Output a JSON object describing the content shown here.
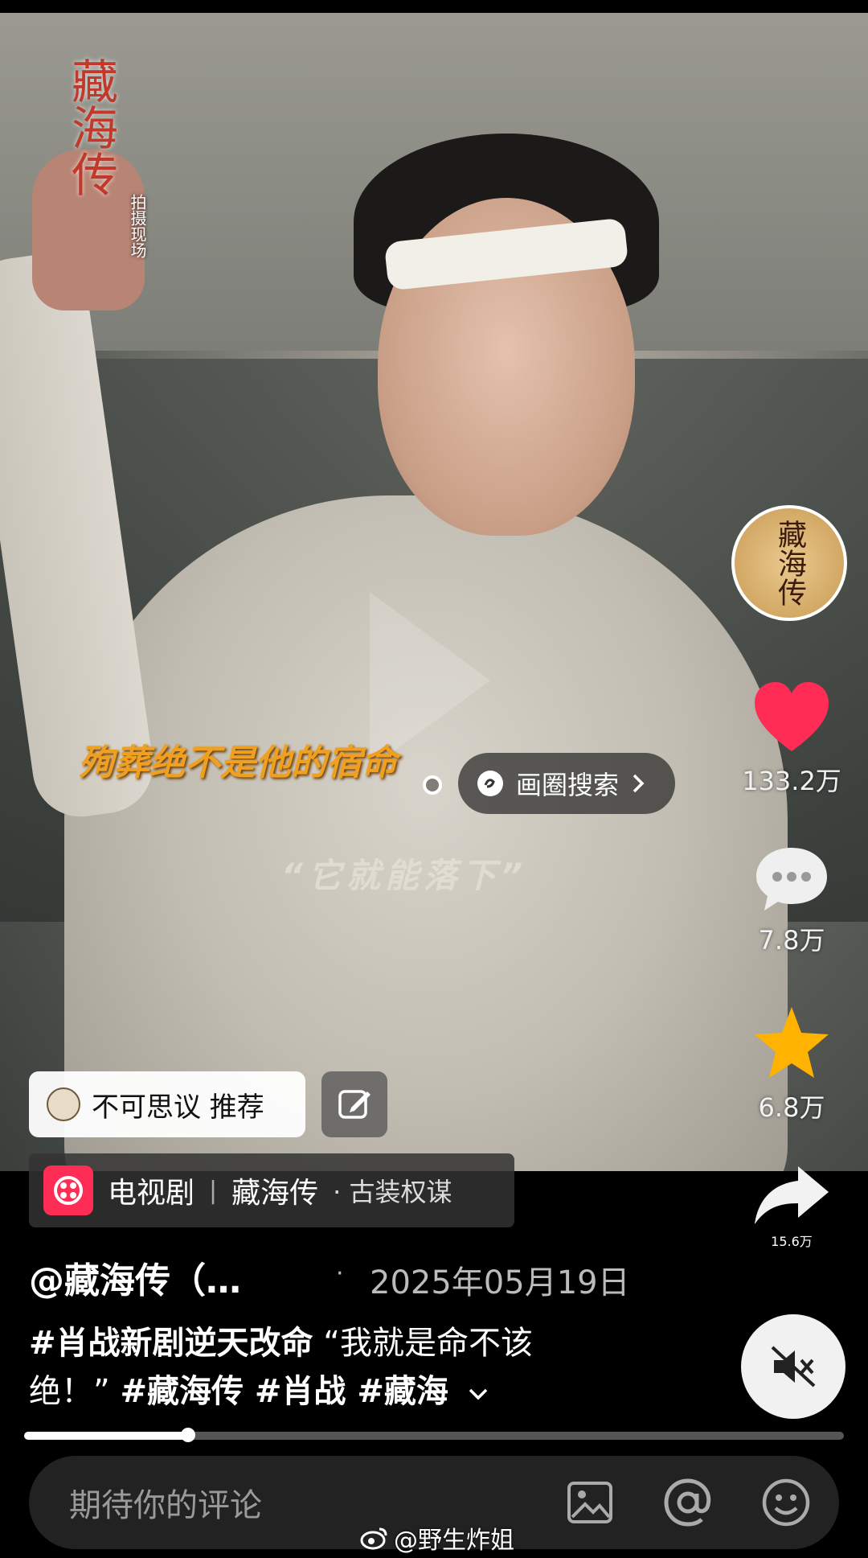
{
  "video": {
    "logo_title": "藏海传",
    "logo_sub": "拍摄现场",
    "subtitle": "殉葬绝不是他的宿命",
    "quote": "“它就能落下”",
    "search_label": "画圈搜索"
  },
  "sidebar": {
    "avatar_text": "藏海传",
    "like_count": "133.2万",
    "comment_count": "7.8万",
    "favorite_count": "6.8万",
    "share_count": "15.6万"
  },
  "recommend": {
    "label": "不可思议 推荐"
  },
  "drama_tag": {
    "category": "电视剧",
    "separator": "|",
    "title": "藏海传",
    "genre": "· 古装权谋"
  },
  "post": {
    "author": "@藏海传（…",
    "date": "2025年05月19日",
    "date_dot": "·",
    "hashtag1": "#肖战新剧逆天改命",
    "quote_part1": "“我就是命不该",
    "quote_part2": "绝！”",
    "hashtags_rest": "#藏海传 #肖战 #藏海",
    "expand_icon": "chevron-down"
  },
  "progress": {
    "fraction": 0.2
  },
  "comment": {
    "placeholder": "期待你的评论"
  },
  "watermark": {
    "text": "@野生炸姐"
  },
  "colors": {
    "like": "#ff2d55",
    "star": "#ffb300",
    "subtitle": "#f0a020"
  }
}
